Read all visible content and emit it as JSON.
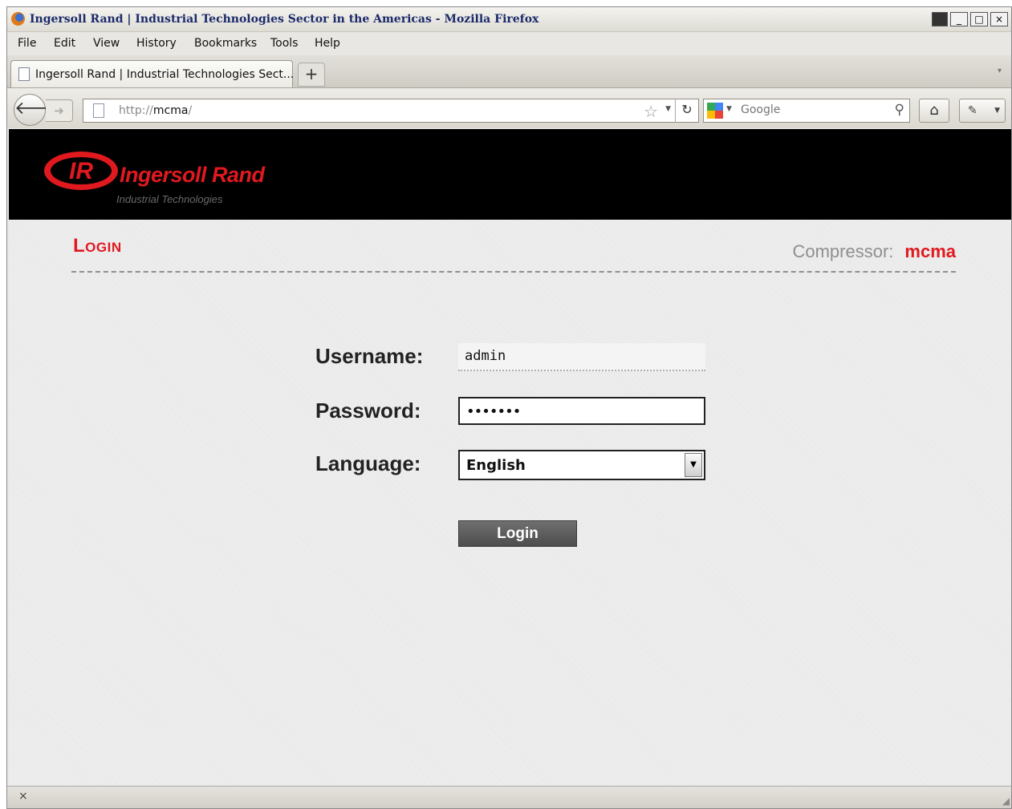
{
  "window": {
    "title": "Ingersoll Rand | Industrial Technologies Sector in the Americas - Mozilla Firefox",
    "controls": [
      "_",
      "□",
      "×"
    ]
  },
  "menubar": {
    "items": [
      {
        "label": "File"
      },
      {
        "label": "Edit"
      },
      {
        "label": "View"
      },
      {
        "label": "History"
      },
      {
        "label": "Bookmarks"
      },
      {
        "label": "Tools"
      },
      {
        "label": "Help"
      }
    ]
  },
  "tabs": [
    {
      "label": "Ingersoll Rand | Industrial Technologies Sect...",
      "active": true
    }
  ],
  "newtab_label": "+",
  "nav": {
    "url_prefix": "http://",
    "url_host": "mcma",
    "url_suffix": "/",
    "search_placeholder": "Google",
    "icons": [
      "back-arrow-icon",
      "forward-arrow-icon",
      "page-icon",
      "star-icon",
      "reload-icon",
      "google-icon",
      "magnifier-icon",
      "home-icon",
      "addons-icon"
    ]
  },
  "page": {
    "brand": "Ingersoll Rand",
    "brand_sub": "Industrial Technologies",
    "logo_letters": "IR",
    "title": "Login",
    "compressor_label": "Compressor:",
    "compressor_value": "mcma",
    "form": {
      "username_label": "Username:",
      "username_value": "admin",
      "password_label": "Password:",
      "password_value": "•••••••",
      "language_label": "Language:",
      "language_value": "English",
      "login_button": "Login"
    },
    "colors": {
      "accent_red": "#e0191f",
      "header_bg": "#000000"
    }
  },
  "statusbar": {
    "close_label": "×"
  }
}
